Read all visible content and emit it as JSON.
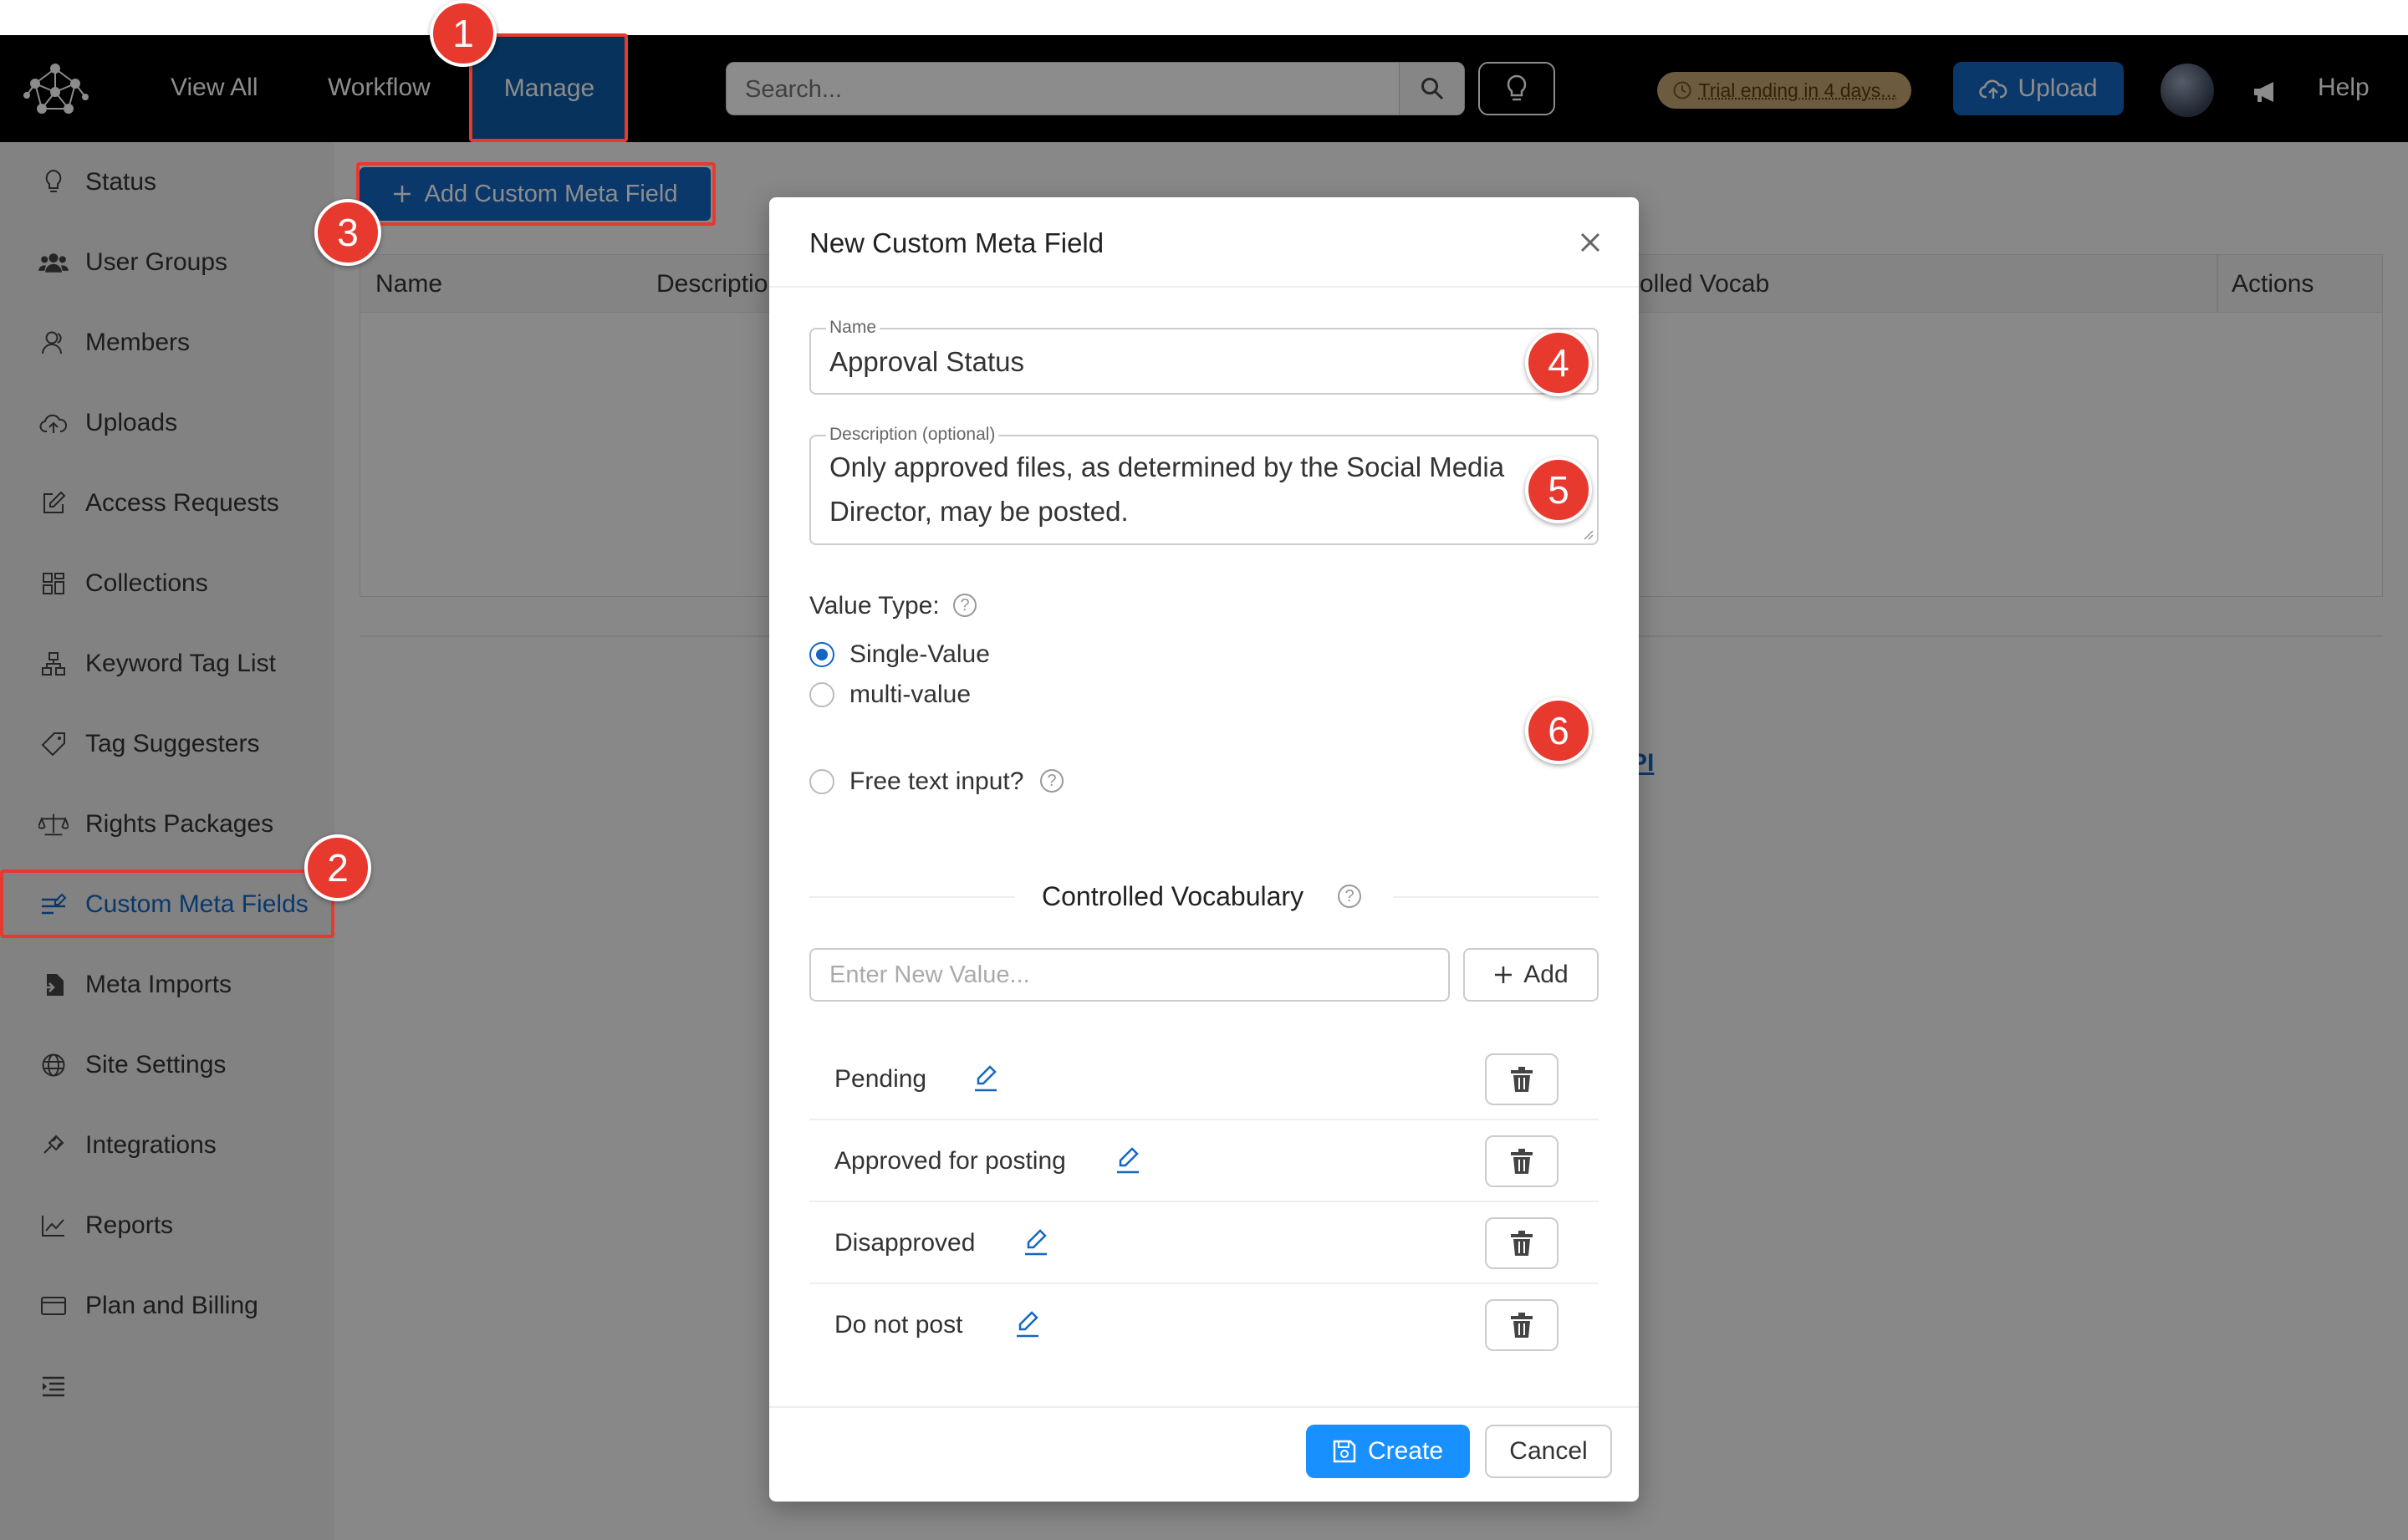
{
  "nav": {
    "view_all": "View All",
    "workflow": "Workflow",
    "manage": "Manage",
    "search_placeholder": "Search...",
    "trial": "Trial ending in 4 days...",
    "upload": "Upload",
    "help": "Help"
  },
  "sidebar": {
    "items": [
      {
        "label": "Status",
        "icon": "lightbulb-icon"
      },
      {
        "label": "User Groups",
        "icon": "users-icon"
      },
      {
        "label": "Members",
        "icon": "member-icon"
      },
      {
        "label": "Uploads",
        "icon": "cloud-upload-icon"
      },
      {
        "label": "Access Requests",
        "icon": "edit-icon"
      },
      {
        "label": "Collections",
        "icon": "collections-icon"
      },
      {
        "label": "Keyword Tag List",
        "icon": "hierarchy-icon"
      },
      {
        "label": "Tag Suggesters",
        "icon": "tag-icon"
      },
      {
        "label": "Rights Packages",
        "icon": "scale-icon"
      },
      {
        "label": "Custom Meta Fields",
        "icon": "custom-meta-icon"
      },
      {
        "label": "Meta Imports",
        "icon": "file-import-icon"
      },
      {
        "label": "Site Settings",
        "icon": "globe-icon"
      },
      {
        "label": "Integrations",
        "icon": "plug-icon"
      },
      {
        "label": "Reports",
        "icon": "line-chart-icon"
      },
      {
        "label": "Plan and Billing",
        "icon": "wallet-icon"
      }
    ],
    "active": "Custom Meta Fields"
  },
  "main": {
    "add_button": "Add Custom Meta Field",
    "columns": [
      "Name",
      "Descriptio",
      "olled Vocab",
      "Actions"
    ],
    "api_link": "PI"
  },
  "modal": {
    "title": "New Custom Meta Field",
    "name_label": "Name",
    "name_value": "Approval Status",
    "description_label": "Description (optional)",
    "description_line1": "Only approved files, as determined by the Social Media",
    "description_line2": "Director, may be posted.",
    "value_type_label": "Value Type:",
    "single_value": "Single-Value",
    "multi_value": "multi-value",
    "free_text": "Free text input?",
    "vocab_title": "Controlled Vocabulary",
    "new_value_placeholder": "Enter New Value...",
    "add_label": "Add",
    "vocab_items": [
      "Pending",
      "Approved for posting",
      "Disapproved",
      "Do not post"
    ],
    "create_label": "Create",
    "cancel_label": "Cancel"
  },
  "callouts": [
    "1",
    "2",
    "3",
    "4",
    "5",
    "6"
  ],
  "colors": {
    "accent": "#1366c4",
    "callout": "#e8392f",
    "primary_button": "#1890ff"
  }
}
